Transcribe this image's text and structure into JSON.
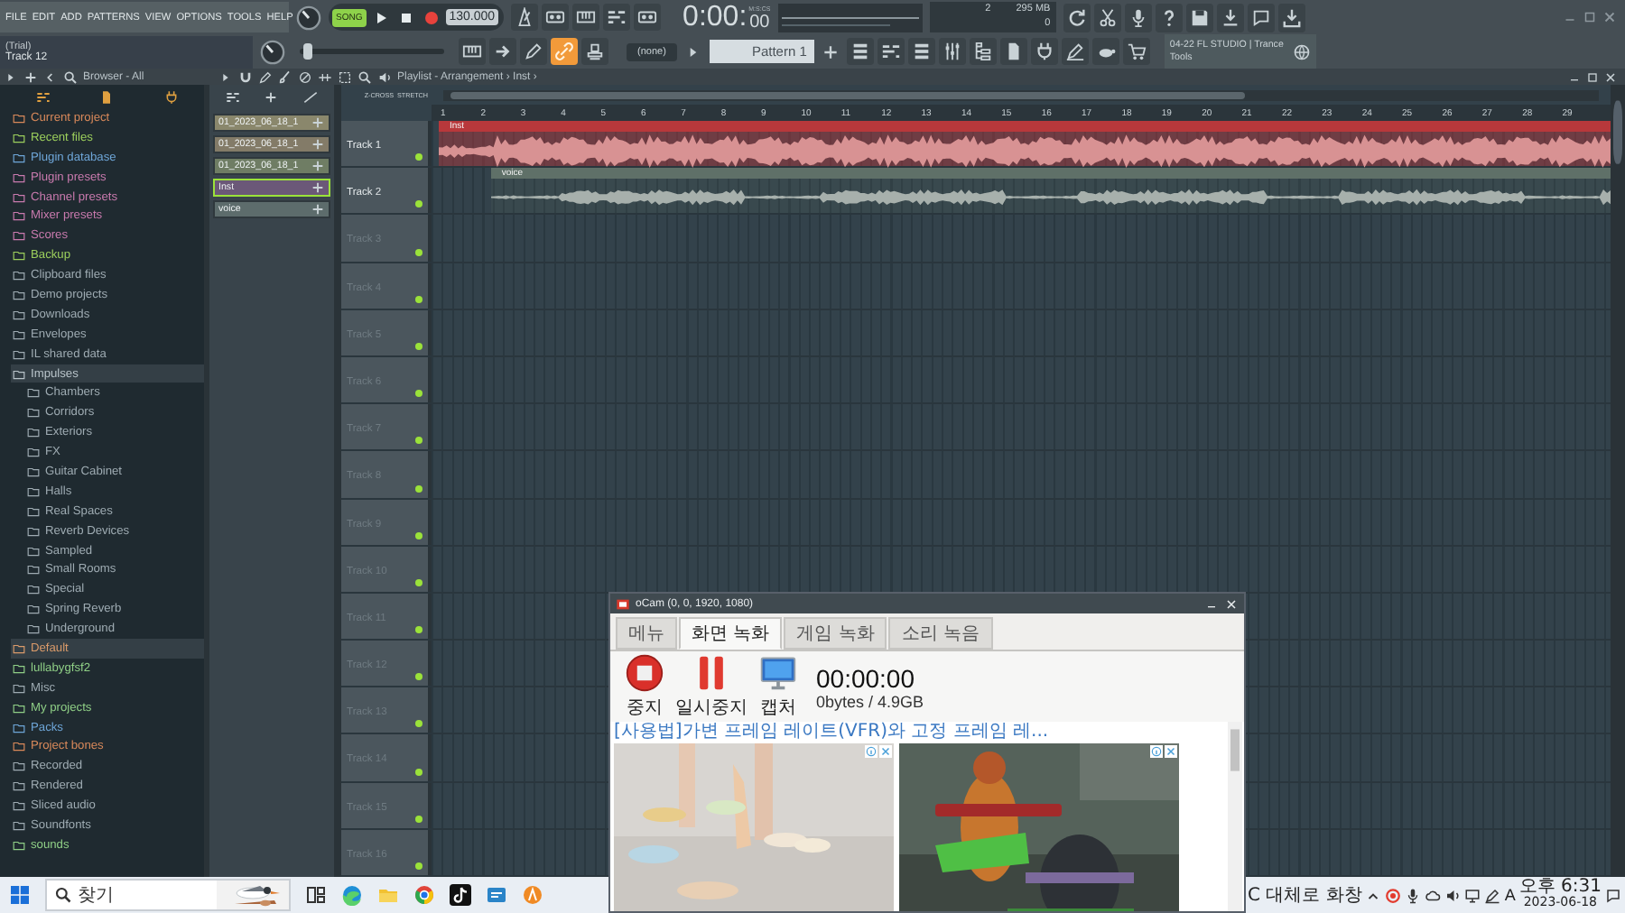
{
  "app_menu": [
    "FILE",
    "EDIT",
    "ADD",
    "PATTERNS",
    "VIEW",
    "OPTIONS",
    "TOOLS",
    "HELP"
  ],
  "hint_panel": {
    "title": "(Trial)",
    "text": "Track 12"
  },
  "transport": {
    "mode": "SONG",
    "song_mode": true,
    "tempo": "130.000"
  },
  "time_display": {
    "time": "0:00:",
    "fraction": "00",
    "unit_label": "M:S:CS"
  },
  "cpu_panel": {
    "polyphony": "2",
    "memory": "295 MB",
    "voices": "0"
  },
  "master_pitch": {
    "level": 0.02
  },
  "pattern_selector": {
    "snap": "(none)",
    "pattern": "Pattern 1"
  },
  "news_panel": {
    "text": "04-22  FL STUDIO | Trance Tools"
  },
  "browser": {
    "title": "Browser - All",
    "items": [
      {
        "label": "Current project",
        "color": "#d9895a",
        "selected": false,
        "expanded": false
      },
      {
        "label": "Recent files",
        "color": "#9ccf5c",
        "selected": false,
        "expanded": false
      },
      {
        "label": "Plugin database",
        "color": "#6ea6d8",
        "selected": false,
        "expanded": false
      },
      {
        "label": "Plugin presets",
        "color": "#c97aae",
        "selected": false,
        "expanded": false
      },
      {
        "label": "Channel presets",
        "color": "#c97aae",
        "selected": false,
        "expanded": false
      },
      {
        "label": "Mixer presets",
        "color": "#c97aae",
        "selected": false,
        "expanded": false
      },
      {
        "label": "Scores",
        "color": "#c97aae",
        "selected": false,
        "expanded": false
      },
      {
        "label": "Backup",
        "color": "#9ccf5c",
        "selected": false,
        "expanded": false
      },
      {
        "label": "Clipboard files",
        "color": "#9eabb2",
        "selected": false,
        "expanded": false
      },
      {
        "label": "Demo projects",
        "color": "#9eabb2",
        "selected": false,
        "expanded": false
      },
      {
        "label": "Downloads",
        "color": "#9eabb2",
        "selected": false,
        "expanded": false
      },
      {
        "label": "Envelopes",
        "color": "#9eabb2",
        "selected": false,
        "expanded": false
      },
      {
        "label": "IL shared data",
        "color": "#9eabb2",
        "selected": false,
        "expanded": false
      },
      {
        "label": "Impulses",
        "color": "#b9c4ca",
        "selected": false,
        "expanded": true,
        "children": [
          {
            "label": "Chambers"
          },
          {
            "label": "Corridors"
          },
          {
            "label": "Exteriors"
          },
          {
            "label": "FX"
          },
          {
            "label": "Guitar Cabinet"
          },
          {
            "label": "Halls"
          },
          {
            "label": "Real Spaces"
          },
          {
            "label": "Reverb Devices"
          },
          {
            "label": "Sampled"
          },
          {
            "label": "Small Rooms"
          },
          {
            "label": "Special"
          },
          {
            "label": "Spring Reverb"
          },
          {
            "label": "Underground"
          }
        ]
      },
      {
        "label": "Default",
        "color": "#d99a6a",
        "selected": true,
        "expanded": false
      },
      {
        "label": "lullabygfsf2",
        "color": "#8fcf86",
        "selected": false,
        "expanded": false
      },
      {
        "label": "Misc",
        "color": "#9eabb2",
        "selected": false,
        "expanded": false
      },
      {
        "label": "My projects",
        "color": "#8fcf86",
        "selected": false,
        "expanded": false
      },
      {
        "label": "Packs",
        "color": "#6ea6d8",
        "selected": false,
        "expanded": false
      },
      {
        "label": "Project bones",
        "color": "#d9895a",
        "selected": false,
        "expanded": false
      },
      {
        "label": "Recorded",
        "color": "#9eabb2",
        "selected": false,
        "expanded": false
      },
      {
        "label": "Rendered",
        "color": "#9eabb2",
        "selected": false,
        "expanded": false
      },
      {
        "label": "Sliced audio",
        "color": "#9eabb2",
        "selected": false,
        "expanded": false
      },
      {
        "label": "Soundfonts",
        "color": "#9eabb2",
        "selected": false,
        "expanded": false
      },
      {
        "label": "sounds",
        "color": "#8fcf86",
        "selected": false,
        "expanded": false
      }
    ]
  },
  "picker": {
    "items": [
      {
        "label": "01_2023_06_18_1",
        "color": "#8a876c",
        "selected": false
      },
      {
        "label": "01_2023_06_18_1",
        "color": "#837b68",
        "selected": false
      },
      {
        "label": "01_2023_06_18_1",
        "color": "#6f7d64",
        "selected": false
      },
      {
        "label": "Inst",
        "color": "#6b5878",
        "selected": true
      },
      {
        "label": "voice",
        "color": "#5d6c6c",
        "selected": false
      }
    ]
  },
  "playlist": {
    "title": "Playlist - Arrangement › Inst ›",
    "options": [
      "Z-CROSS",
      "STRETCH"
    ],
    "bars": [
      "1",
      "2",
      "3",
      "4",
      "5",
      "6",
      "7",
      "8",
      "9",
      "10",
      "11",
      "12",
      "13",
      "14",
      "15",
      "16",
      "17",
      "18",
      "19",
      "20",
      "21",
      "22",
      "23",
      "24",
      "25",
      "26",
      "27",
      "28",
      "29"
    ],
    "tracks": [
      {
        "name": "Track 1",
        "clip": {
          "name": "Inst",
          "color": "#b8383b"
        }
      },
      {
        "name": "Track 2",
        "clip": {
          "name": "voice",
          "color": "#5f7068"
        }
      },
      {
        "name": "Track 3"
      },
      {
        "name": "Track 4"
      },
      {
        "name": "Track 5"
      },
      {
        "name": "Track 6"
      },
      {
        "name": "Track 7"
      },
      {
        "name": "Track 8"
      },
      {
        "name": "Track 9"
      },
      {
        "name": "Track 10"
      },
      {
        "name": "Track 11"
      },
      {
        "name": "Track 12"
      },
      {
        "name": "Track 13"
      },
      {
        "name": "Track 14"
      },
      {
        "name": "Track 15"
      },
      {
        "name": "Track 16"
      }
    ]
  },
  "ocam": {
    "title": "oCam (0, 0, 1920, 1080)",
    "tabs": [
      {
        "label": "메뉴",
        "selected": false
      },
      {
        "label": "화면 녹화",
        "selected": true
      },
      {
        "label": "게임 녹화",
        "selected": false
      },
      {
        "label": "소리 녹음",
        "selected": false
      }
    ],
    "buttons": [
      {
        "kind": "stop",
        "label": "중지"
      },
      {
        "kind": "pause",
        "label": "일시중지"
      },
      {
        "kind": "capture",
        "label": "캡처"
      }
    ],
    "elapsed": "00:00:00",
    "size": "0bytes / 4.9GB",
    "link": "[사용법]가변 프레임 레이트(VFR)와 고정 프레임 레..."
  },
  "taskbar": {
    "search": {
      "placeholder": "찾기"
    },
    "weather": "C 대체로 화창",
    "input_indicator": "A",
    "time": "오후 6:31",
    "date": "2023-06-18"
  }
}
